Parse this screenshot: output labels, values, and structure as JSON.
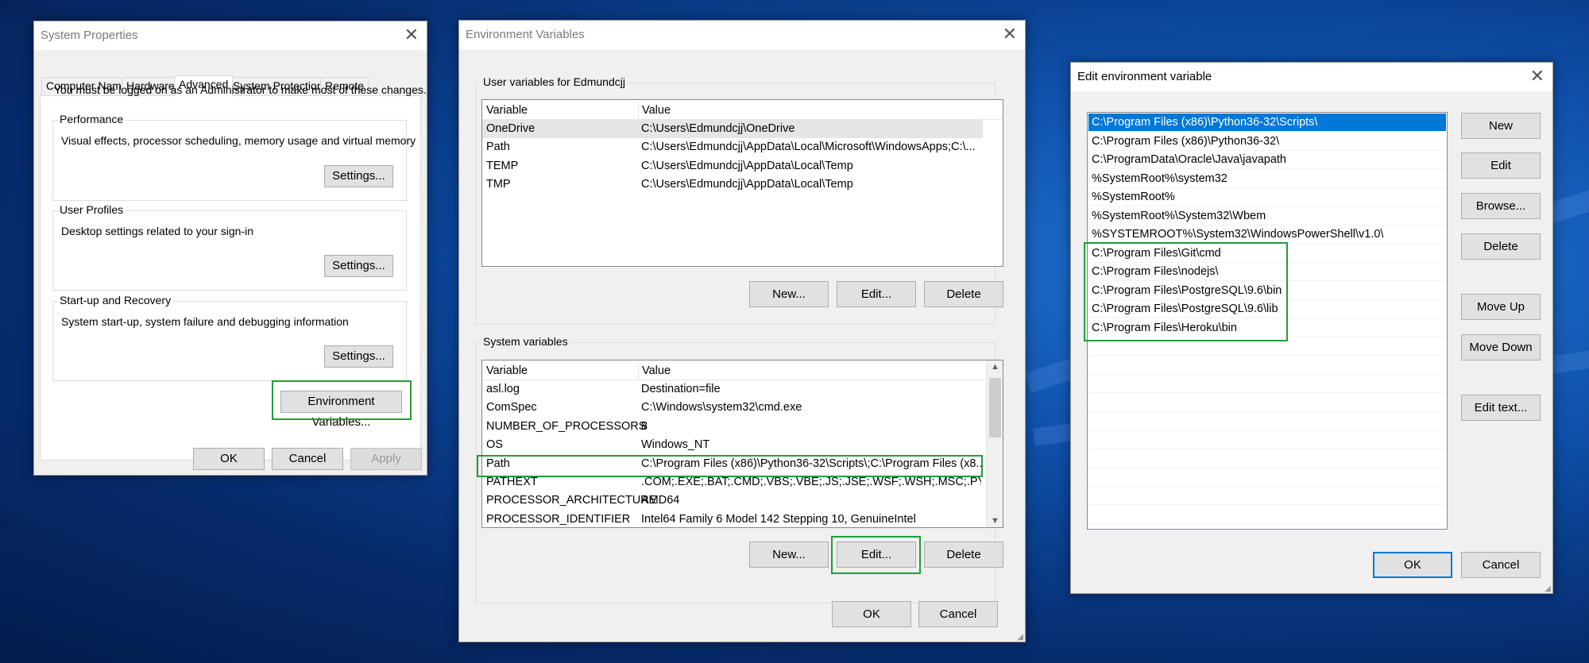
{
  "system_properties": {
    "title": "System Properties",
    "tabs": [
      "Computer Name",
      "Hardware",
      "Advanced",
      "System Protection",
      "Remote"
    ],
    "admin_note": "You must be logged on as an Administrator to make most of these changes.",
    "performance": {
      "label": "Performance",
      "desc": "Visual effects, processor scheduling, memory usage and virtual memory",
      "button": "Settings..."
    },
    "user_profiles": {
      "label": "User Profiles",
      "desc": "Desktop settings related to your sign-in",
      "button": "Settings..."
    },
    "startup": {
      "label": "Start-up and Recovery",
      "desc": "System start-up, system failure and debugging information",
      "button": "Settings..."
    },
    "env_button": "Environment Variables...",
    "ok": "OK",
    "cancel": "Cancel",
    "apply": "Apply"
  },
  "env_vars": {
    "title": "Environment Variables",
    "user_group": "User variables for Edmundcjj",
    "headers": [
      "Variable",
      "Value"
    ],
    "user_rows": [
      [
        "OneDrive",
        "C:\\Users\\Edmundcjj\\OneDrive"
      ],
      [
        "Path",
        "C:\\Users\\Edmundcjj\\AppData\\Local\\Microsoft\\WindowsApps;C:\\..."
      ],
      [
        "TEMP",
        "C:\\Users\\Edmundcjj\\AppData\\Local\\Temp"
      ],
      [
        "TMP",
        "C:\\Users\\Edmundcjj\\AppData\\Local\\Temp"
      ]
    ],
    "system_group": "System variables",
    "system_rows": [
      [
        "asl.log",
        "Destination=file"
      ],
      [
        "ComSpec",
        "C:\\Windows\\system32\\cmd.exe"
      ],
      [
        "NUMBER_OF_PROCESSORS",
        "8"
      ],
      [
        "OS",
        "Windows_NT"
      ],
      [
        "Path",
        "C:\\Program Files (x86)\\Python36-32\\Scripts\\;C:\\Program Files (x8..."
      ],
      [
        "PATHEXT",
        ".COM;.EXE;.BAT;.CMD;.VBS;.VBE;.JS;.JSE;.WSF;.WSH;.MSC;.PY;.PYW"
      ],
      [
        "PROCESSOR_ARCHITECTURE",
        "AMD64"
      ],
      [
        "PROCESSOR_IDENTIFIER",
        "Intel64 Family 6 Model 142 Stepping 10, GenuineIntel"
      ]
    ],
    "new": "New...",
    "edit": "Edit...",
    "delete": "Delete",
    "ok": "OK",
    "cancel": "Cancel"
  },
  "edit_env": {
    "title": "Edit environment variable",
    "paths": [
      "C:\\Program Files (x86)\\Python36-32\\Scripts\\",
      "C:\\Program Files (x86)\\Python36-32\\",
      "C:\\ProgramData\\Oracle\\Java\\javapath",
      "%SystemRoot%\\system32",
      "%SystemRoot%",
      "%SystemRoot%\\System32\\Wbem",
      "%SYSTEMROOT%\\System32\\WindowsPowerShell\\v1.0\\",
      "C:\\Program Files\\Git\\cmd",
      "C:\\Program Files\\nodejs\\",
      "C:\\Program Files\\PostgreSQL\\9.6\\bin",
      "C:\\Program Files\\PostgreSQL\\9.6\\lib",
      "C:\\Program Files\\Heroku\\bin"
    ],
    "buttons": {
      "new": "New",
      "edit": "Edit",
      "browse": "Browse...",
      "delete": "Delete",
      "move_up": "Move Up",
      "move_down": "Move Down",
      "edit_text": "Edit text..."
    },
    "ok": "OK",
    "cancel": "Cancel"
  },
  "colors": {
    "highlight": "#1f9e3a",
    "selection": "#0078d7"
  }
}
